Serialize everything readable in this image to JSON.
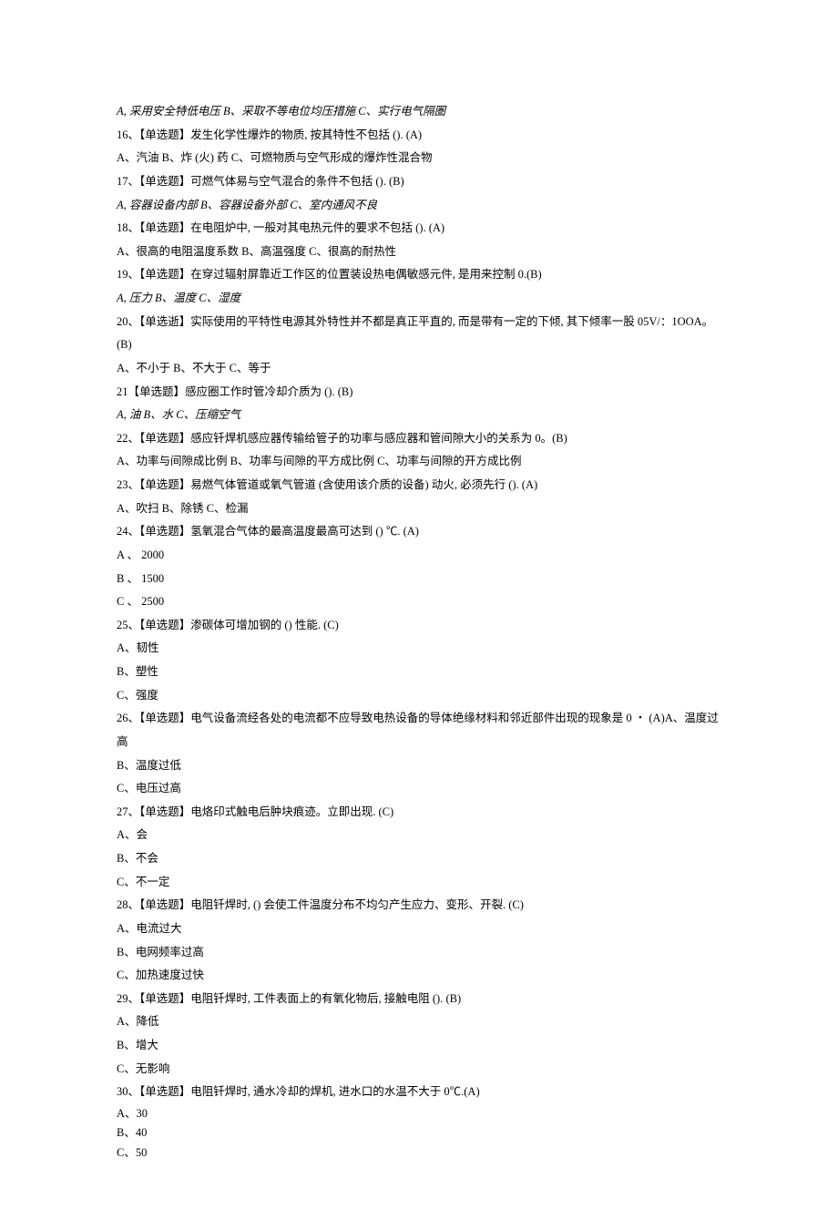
{
  "lines": [
    "A, 采用安全特低电压 B、采取不等电位均压措施 C、实行电气隔圏",
    "16、【单选题】发生化学性爆炸的物质, 按其特性不包括 (). (A)",
    "A、汽油 B、炸 (火) 药 C、可燃物质与空气形成的爆炸性混合物",
    "17、【单选题】可燃气体易与空气混合的条件不包括 (). (B)",
    "A, 容器设备内部 B、容器设备外部 C、室内通风不良",
    "18、【单选题】在电阻炉中, 一般对其电热元件的要求不包括 (). (A)",
    "A、很高的电阻温度系数 B、高温强度 C、很高的耐热性",
    "19、【单选题】在穿过辐射屏靠近工作区的位置装设热电偶敏感元件, 是用来控制 0.(B)",
    "A, 压力 B、温度 C、湿度",
    "20、【单选逝】实际使用的平特性电源其外特性并不都是真正平直的, 而是带有一定的下倾, 其下倾率一股 05V/：1OOA。",
    "(B)",
    "A、不小于 B、不大于 C、等于",
    "21【单选题】感应圈工作时管冷却介质为 (). (B)",
    "A, 油 B、水 C、压缩空气",
    "22、【单选题】感应钎焊机感应器传输给管子的功率与感应器和管间隙大小的关系为 0。(B)",
    "A、功率与间隙成比例 B、功率与间隙的平方成比例 C、功率与间隙的开方成比例",
    "23、【单选题】易燃气体管道或氧气管道 (含使用该介质的设备) 动火, 必须先行 (). (A)",
    "A、吹扫 B、除锈 C、检漏",
    "24、【单选题】氢氧混合气体的最高温度最高可达到 () ℃. (A)",
    "A 、 2000",
    "B 、 1500",
    "C 、 2500",
    "25、【单选题】渗碳体可增加钢的 () 性能. (C)",
    "A、韧性",
    "B、塑性",
    "C、强度",
    "26、【单选题】电气设备流经各处的电流都不应导致电热设备的导体绝缘材料和邻近部件出现的现象是 0 ・ (A)A、温度过高",
    "B、温度过低",
    "C、电压过高",
    "27、【单选题】电烙印式触电后肿块痕迹。立即出现. (C)",
    "A、会",
    "B、不会",
    "C、不一定",
    "28、【单选题】电阻钎焊时, () 会使工件温度分布不均匀产生应力、变形、开裂. (C)",
    "A、电流过大",
    "B、电网频率过高",
    "C、加热速度过快",
    "29、【单选题】电阻钎焊时, 工件表面上的有氧化物后, 接触电阻 (). (B)",
    "A、降低",
    "B、增大",
    "C、无影响",
    "30、【单选题】电阻钎焊时, 通水冷却的焊机, 进水口的水温不大于 0℃.(A)",
    "A、30",
    "B、40",
    "C、50"
  ]
}
